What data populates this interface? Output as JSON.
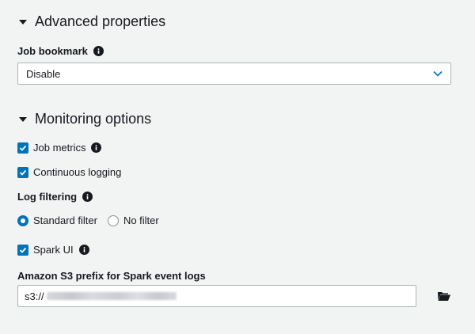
{
  "advanced": {
    "title": "Advanced properties",
    "job_bookmark": {
      "label": "Job bookmark",
      "selected": "Disable"
    }
  },
  "monitoring": {
    "title": "Monitoring options",
    "job_metrics": {
      "label": "Job metrics",
      "checked": true
    },
    "continuous_logging": {
      "label": "Continuous logging",
      "checked": true
    },
    "log_filtering": {
      "label": "Log filtering",
      "options": [
        {
          "label": "Standard filter",
          "selected": true
        },
        {
          "label": "No filter",
          "selected": false
        }
      ]
    },
    "spark_ui": {
      "label": "Spark UI",
      "checked": true
    },
    "s3_prefix": {
      "label": "Amazon S3 prefix for Spark event logs",
      "value": "s3://"
    }
  },
  "colors": {
    "accent": "#0073bb",
    "background": "#f2f3f3",
    "text": "#16191f"
  }
}
